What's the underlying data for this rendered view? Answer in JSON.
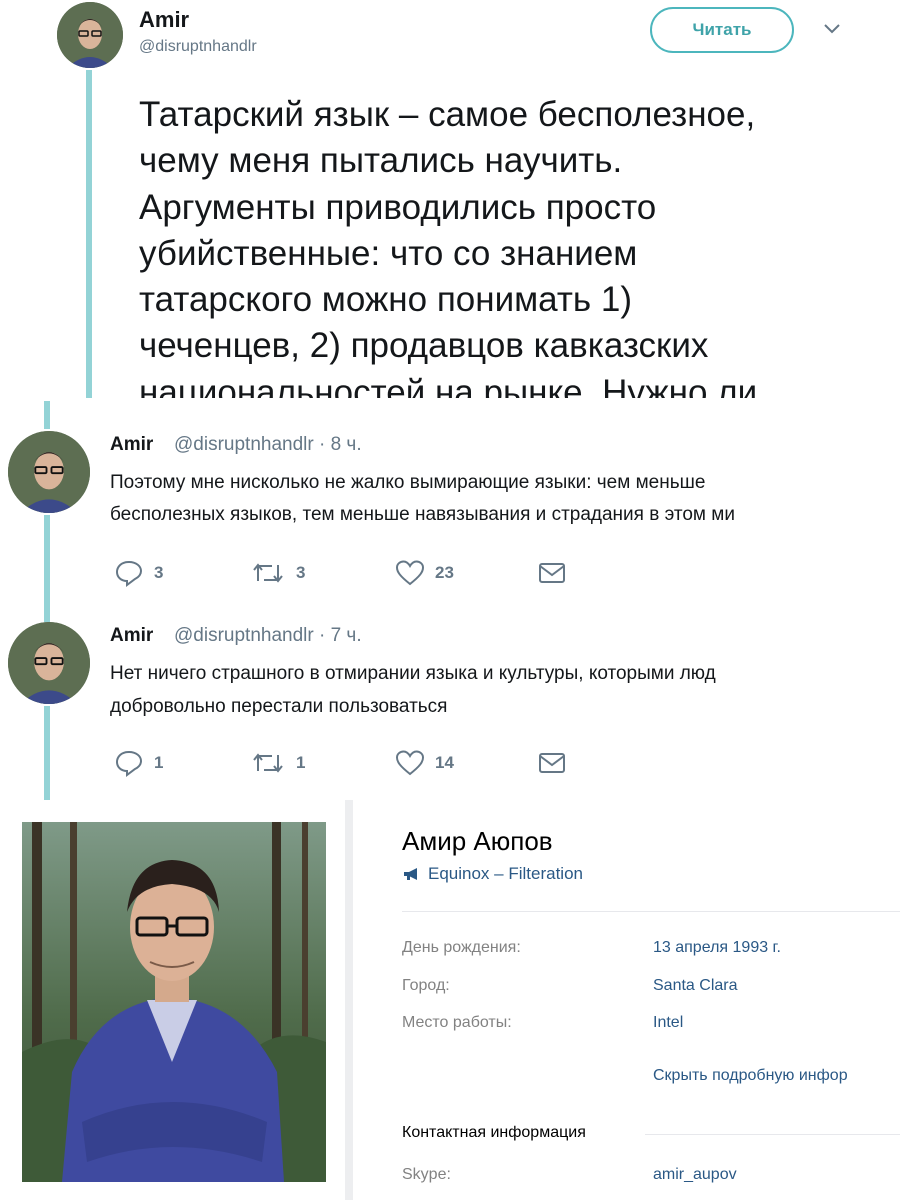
{
  "tweet_main": {
    "author_name": "Amir",
    "handle": "@disruptnhandlr",
    "follow_label": "Читать",
    "text": "Татарский язык – самое бесполезное,\nчему меня пытались научить.\nАргументы приводились просто\nубийственные: что со знанием\nтатарского можно понимать 1)\nчеченцев, 2) продавцов кавказских\nнациональностей на рынке. Нужно ли"
  },
  "tweet_2": {
    "author_name": "Amir",
    "meta": "@disruptnhandlr · 8 ч.",
    "line1": "Поэтому мне нисколько не жалко вымирающие языки: чем меньше",
    "line2": "бесполезных языков, тем меньше навязывания и страдания в этом ми",
    "replies": "3",
    "retweets": "3",
    "likes": "23"
  },
  "tweet_3": {
    "author_name": "Amir",
    "meta": "@disruptnhandlr · 7 ч.",
    "line1": "Нет ничего страшного в отмирании языка и культуры, которыми люд",
    "line2": "добровольно перестали пользоваться",
    "replies": "1",
    "retweets": "1",
    "likes": "14"
  },
  "vk_profile": {
    "name": "Амир Аюпов",
    "status": "Equinox – Filteration",
    "fields": [
      {
        "label": "День рождения:",
        "value": "13 апреля 1993 г."
      },
      {
        "label": "Город:",
        "value": "Santa Clara"
      },
      {
        "label": "Место работы:",
        "value": "Intel"
      }
    ],
    "hide_link": "Скрыть подробную инфор",
    "contact_section": "Контактная информация",
    "skype_label": "Skype:",
    "skype_value": "amir_aupov"
  },
  "colors": {
    "thread_line": "#93d3d6",
    "follow_border": "#4cb6bd",
    "vk_link": "#2a5885",
    "muted": "#657786"
  }
}
